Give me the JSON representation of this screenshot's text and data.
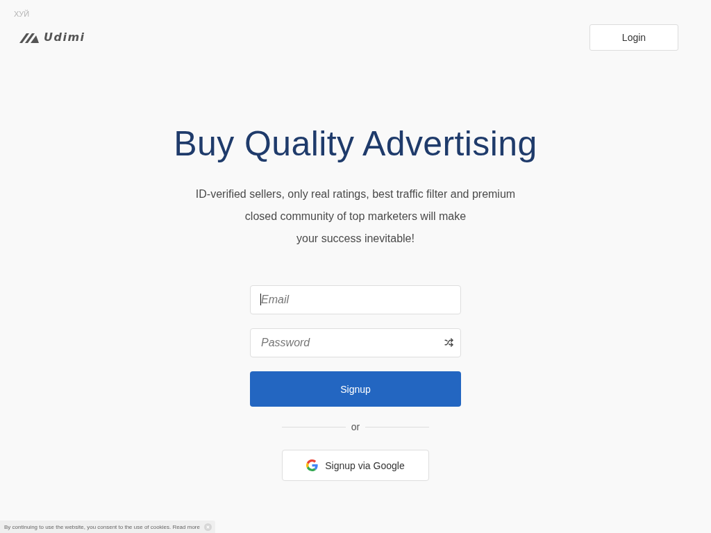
{
  "top_note": "ХУЙ",
  "header": {
    "logo": {
      "text": "Udimi"
    },
    "login_button": "Login"
  },
  "hero": {
    "title": "Buy Quality Advertising",
    "subtitle_lines": [
      "ID-verified sellers, only real ratings, best traffic filter and premium",
      "closed community of top marketers will make",
      "your success inevitable!"
    ]
  },
  "form": {
    "fields": [
      {
        "kind": "email",
        "placeholder": "Email",
        "focused": true
      },
      {
        "kind": "password",
        "placeholder": "Password",
        "focused": false
      }
    ],
    "submit_button": "Signup",
    "divider": "or",
    "google_button": "Signup via Google"
  },
  "cookie_bar": {
    "text": "By continuing to use the website, you consent to the use of cookies.",
    "link": "Read more"
  }
}
